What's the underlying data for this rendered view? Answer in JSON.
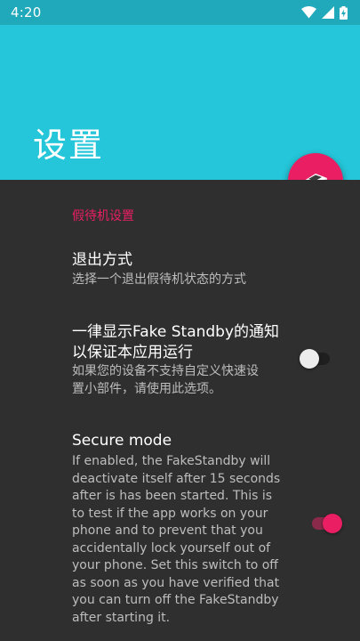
{
  "status_bar": {
    "time": "4:20",
    "icons": [
      "wifi-icon",
      "cellular-signal-icon",
      "battery-charging-icon"
    ]
  },
  "app_bar": {
    "title": "设置",
    "background_color": "#25c6d9"
  },
  "fab": {
    "icon": "standby-icon",
    "color": "#e91e63"
  },
  "preferences": {
    "category": "假待机设置",
    "exit_mode": {
      "title": "退出方式",
      "summary": "选择一个退出假待机状态的方式"
    },
    "show_notification": {
      "title_line1": "一律显示Fake Standby的通知",
      "title_line2": "以保证本应用运行",
      "summary_line1": "如果您的设备不支持自定义快速设",
      "summary_line2": "置小部件，请使用此选项。",
      "enabled": false
    },
    "secure_mode": {
      "title": "Secure mode",
      "summary_lines": [
        "If enabled, the FakeStandby will",
        "deactivate itself after 15 seconds",
        "after is has been started. This is",
        "to test if the app works on your",
        "phone and to prevent that you",
        "accidentally lock yourself out of",
        "your phone. Set this switch to off",
        "as soon as you have verified that",
        "you can turn off the FakeStandby",
        "after starting it."
      ],
      "enabled": true
    }
  }
}
